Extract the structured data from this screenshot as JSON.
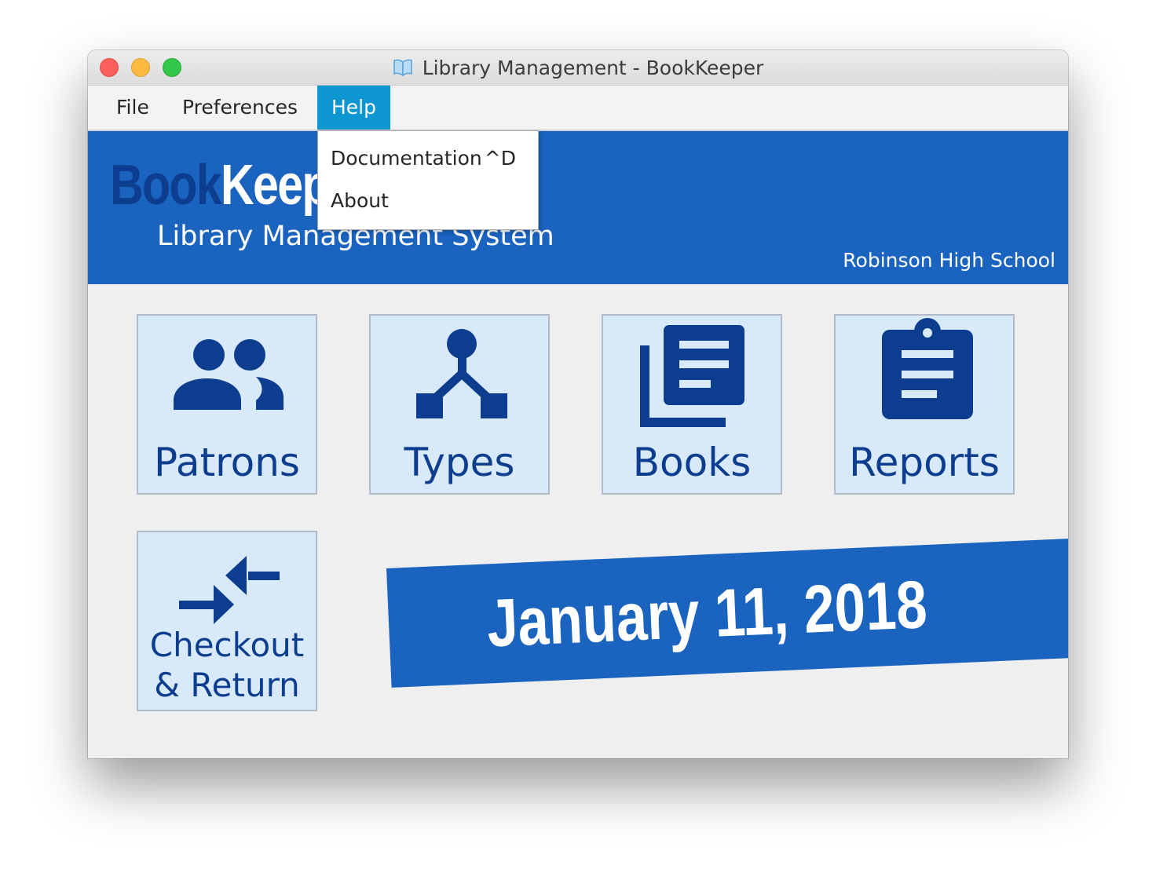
{
  "window": {
    "title": "Library Management - BookKeeper",
    "title_icon": "book-open-icon"
  },
  "menubar": {
    "items": [
      {
        "label": "File"
      },
      {
        "label": "Preferences"
      },
      {
        "label": "Help",
        "active": true
      }
    ]
  },
  "help_menu": {
    "items": [
      {
        "label": "Documentation",
        "shortcut": "^D"
      },
      {
        "label": "About"
      }
    ]
  },
  "header": {
    "logo_part1": "Book",
    "logo_part2": "Keeper",
    "subtitle": "Library Management System",
    "school": "Robinson High School"
  },
  "tiles": [
    {
      "label": "Patrons",
      "icon": "people-icon"
    },
    {
      "label": "Types",
      "icon": "hierarchy-icon"
    },
    {
      "label": "Books",
      "icon": "library-books-icon"
    },
    {
      "label": "Reports",
      "icon": "clipboard-icon"
    },
    {
      "label": "Checkout\n& Return",
      "icon": "swap-arrows-icon"
    }
  ],
  "date": "January 11, 2018",
  "colors": {
    "brand_blue": "#1a63bf",
    "dark_blue": "#0c3d8e",
    "tile_bg": "#d8e9fa",
    "menu_active": "#0e96d2"
  }
}
